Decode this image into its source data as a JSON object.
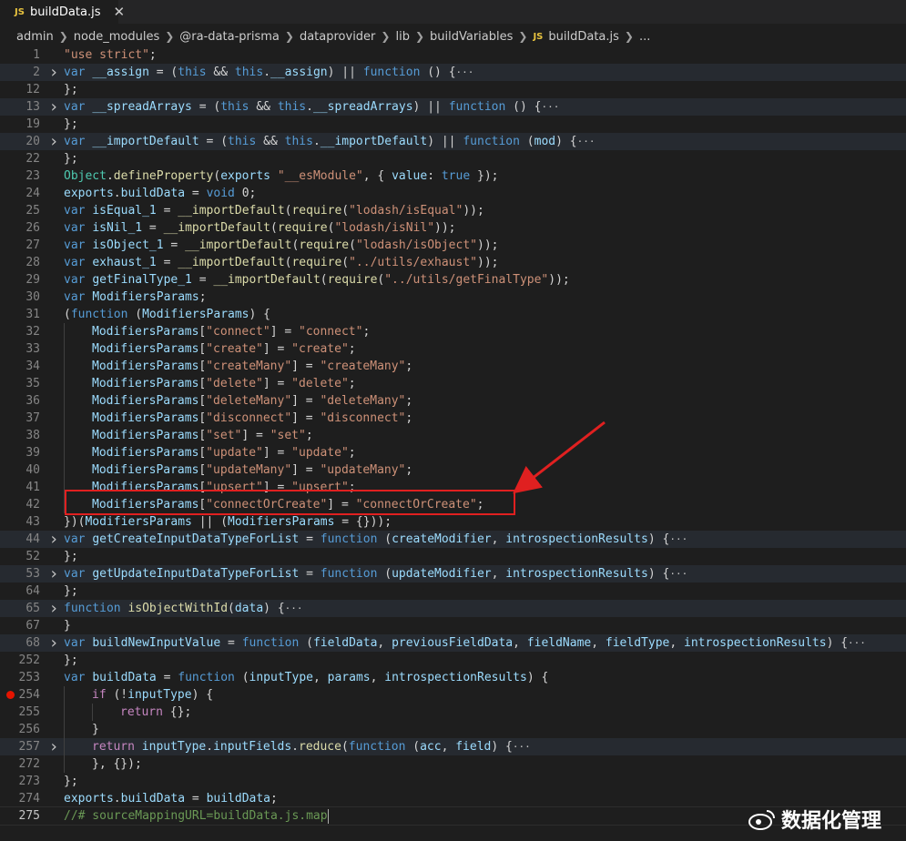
{
  "tab": {
    "badge": "JS",
    "filename": "buildData.js",
    "close": "✕"
  },
  "breadcrumb": {
    "parts": [
      "admin",
      "node_modules",
      "@ra-data-prisma",
      "dataprovider",
      "lib",
      "buildVariables"
    ],
    "file_badge": "JS",
    "file": "buildData.js",
    "tail": "..."
  },
  "lines": [
    {
      "n": "1",
      "t": [
        [
          "str",
          "\"use strict\""
        ],
        [
          "",
          "; "
        ]
      ]
    },
    {
      "n": "2",
      "fold": true,
      "t": [
        [
          "kw",
          "var"
        ],
        [
          "",
          " "
        ],
        [
          "var",
          "__assign"
        ],
        [
          "",
          " = ("
        ],
        [
          "kw",
          "this"
        ],
        [
          "",
          " && "
        ],
        [
          "kw",
          "this"
        ],
        [
          "",
          "."
        ],
        [
          "var",
          "__assign"
        ],
        [
          "",
          ") || "
        ],
        [
          "kw",
          "function"
        ],
        [
          "",
          " () {"
        ],
        [
          "ell",
          "···"
        ]
      ]
    },
    {
      "n": "12",
      "t": [
        [
          "",
          "};"
        ]
      ]
    },
    {
      "n": "13",
      "fold": true,
      "t": [
        [
          "kw",
          "var"
        ],
        [
          "",
          " "
        ],
        [
          "var",
          "__spreadArrays"
        ],
        [
          "",
          " = ("
        ],
        [
          "kw",
          "this"
        ],
        [
          "",
          " && "
        ],
        [
          "kw",
          "this"
        ],
        [
          "",
          "."
        ],
        [
          "var",
          "__spreadArrays"
        ],
        [
          "",
          ") || "
        ],
        [
          "kw",
          "function"
        ],
        [
          "",
          " () {"
        ],
        [
          "ell",
          "···"
        ]
      ]
    },
    {
      "n": "19",
      "t": [
        [
          "",
          "};"
        ]
      ]
    },
    {
      "n": "20",
      "fold": true,
      "t": [
        [
          "kw",
          "var"
        ],
        [
          "",
          " "
        ],
        [
          "var",
          "__importDefault"
        ],
        [
          "",
          " = ("
        ],
        [
          "kw",
          "this"
        ],
        [
          "",
          " && "
        ],
        [
          "kw",
          "this"
        ],
        [
          "",
          "."
        ],
        [
          "var",
          "__importDefault"
        ],
        [
          "",
          ") || "
        ],
        [
          "kw",
          "function"
        ],
        [
          "",
          " ("
        ],
        [
          "var",
          "mod"
        ],
        [
          "",
          ") {"
        ],
        [
          "ell",
          "···"
        ]
      ]
    },
    {
      "n": "22",
      "t": [
        [
          "",
          "};"
        ]
      ]
    },
    {
      "n": "23",
      "t": [
        [
          "cls",
          "Object"
        ],
        [
          "",
          "."
        ],
        [
          "fn",
          "defineProperty"
        ],
        [
          "",
          "("
        ],
        [
          "var",
          "exports"
        ],
        [
          ",",
          ""
        ],
        [
          "",
          " "
        ],
        [
          "str",
          "\"__esModule\""
        ],
        [
          "",
          ", { "
        ],
        [
          "var",
          "value"
        ],
        [
          "",
          ": "
        ],
        [
          "kw",
          "true"
        ],
        [
          "",
          " });"
        ]
      ]
    },
    {
      "n": "24",
      "t": [
        [
          "var",
          "exports"
        ],
        [
          "",
          "."
        ],
        [
          "var",
          "buildData"
        ],
        [
          "",
          " = "
        ],
        [
          "kw",
          "void"
        ],
        [
          "",
          " 0;"
        ]
      ]
    },
    {
      "n": "25",
      "t": [
        [
          "kw",
          "var"
        ],
        [
          "",
          " "
        ],
        [
          "var",
          "isEqual_1"
        ],
        [
          "",
          " = "
        ],
        [
          "fn",
          "__importDefault"
        ],
        [
          "",
          "("
        ],
        [
          "fn",
          "require"
        ],
        [
          "",
          "("
        ],
        [
          "str",
          "\"lodash/isEqual\""
        ],
        [
          "",
          "));"
        ]
      ]
    },
    {
      "n": "26",
      "t": [
        [
          "kw",
          "var"
        ],
        [
          "",
          " "
        ],
        [
          "var",
          "isNil_1"
        ],
        [
          "",
          " = "
        ],
        [
          "fn",
          "__importDefault"
        ],
        [
          "",
          "("
        ],
        [
          "fn",
          "require"
        ],
        [
          "",
          "("
        ],
        [
          "str",
          "\"lodash/isNil\""
        ],
        [
          "",
          "));"
        ]
      ]
    },
    {
      "n": "27",
      "t": [
        [
          "kw",
          "var"
        ],
        [
          "",
          " "
        ],
        [
          "var",
          "isObject_1"
        ],
        [
          "",
          " = "
        ],
        [
          "fn",
          "__importDefault"
        ],
        [
          "",
          "("
        ],
        [
          "fn",
          "require"
        ],
        [
          "",
          "("
        ],
        [
          "str",
          "\"lodash/isObject\""
        ],
        [
          "",
          "));"
        ]
      ]
    },
    {
      "n": "28",
      "t": [
        [
          "kw",
          "var"
        ],
        [
          "",
          " "
        ],
        [
          "var",
          "exhaust_1"
        ],
        [
          "",
          " = "
        ],
        [
          "fn",
          "__importDefault"
        ],
        [
          "",
          "("
        ],
        [
          "fn",
          "require"
        ],
        [
          "",
          "("
        ],
        [
          "str",
          "\"../utils/exhaust\""
        ],
        [
          "",
          "));"
        ]
      ]
    },
    {
      "n": "29",
      "t": [
        [
          "kw",
          "var"
        ],
        [
          "",
          " "
        ],
        [
          "var",
          "getFinalType_1"
        ],
        [
          "",
          " = "
        ],
        [
          "fn",
          "__importDefault"
        ],
        [
          "",
          "("
        ],
        [
          "fn",
          "require"
        ],
        [
          "",
          "("
        ],
        [
          "str",
          "\"../utils/getFinalType\""
        ],
        [
          "",
          "));"
        ]
      ]
    },
    {
      "n": "30",
      "t": [
        [
          "kw",
          "var"
        ],
        [
          "",
          " "
        ],
        [
          "var",
          "ModifiersParams"
        ],
        [
          "",
          ";"
        ]
      ]
    },
    {
      "n": "31",
      "t": [
        [
          "",
          "("
        ],
        [
          "kw",
          "function"
        ],
        [
          "",
          " ("
        ],
        [
          "var",
          "ModifiersParams"
        ],
        [
          "",
          ") {"
        ]
      ]
    },
    {
      "n": "32",
      "i": 1,
      "t": [
        [
          "var",
          "ModifiersParams"
        ],
        [
          "",
          "["
        ],
        [
          "str",
          "\"connect\""
        ],
        [
          "",
          "] = "
        ],
        [
          "str",
          "\"connect\""
        ],
        [
          "",
          ";"
        ]
      ]
    },
    {
      "n": "33",
      "i": 1,
      "t": [
        [
          "var",
          "ModifiersParams"
        ],
        [
          "",
          "["
        ],
        [
          "str",
          "\"create\""
        ],
        [
          "",
          "] = "
        ],
        [
          "str",
          "\"create\""
        ],
        [
          "",
          ";"
        ]
      ]
    },
    {
      "n": "34",
      "i": 1,
      "t": [
        [
          "var",
          "ModifiersParams"
        ],
        [
          "",
          "["
        ],
        [
          "str",
          "\"createMany\""
        ],
        [
          "",
          "] = "
        ],
        [
          "str",
          "\"createMany\""
        ],
        [
          "",
          ";"
        ]
      ]
    },
    {
      "n": "35",
      "i": 1,
      "t": [
        [
          "var",
          "ModifiersParams"
        ],
        [
          "",
          "["
        ],
        [
          "str",
          "\"delete\""
        ],
        [
          "",
          "] = "
        ],
        [
          "str",
          "\"delete\""
        ],
        [
          "",
          ";"
        ]
      ]
    },
    {
      "n": "36",
      "i": 1,
      "t": [
        [
          "var",
          "ModifiersParams"
        ],
        [
          "",
          "["
        ],
        [
          "str",
          "\"deleteMany\""
        ],
        [
          "",
          "] = "
        ],
        [
          "str",
          "\"deleteMany\""
        ],
        [
          "",
          ";"
        ]
      ]
    },
    {
      "n": "37",
      "i": 1,
      "t": [
        [
          "var",
          "ModifiersParams"
        ],
        [
          "",
          "["
        ],
        [
          "str",
          "\"disconnect\""
        ],
        [
          "",
          "] = "
        ],
        [
          "str",
          "\"disconnect\""
        ],
        [
          "",
          ";"
        ]
      ]
    },
    {
      "n": "38",
      "i": 1,
      "t": [
        [
          "var",
          "ModifiersParams"
        ],
        [
          "",
          "["
        ],
        [
          "str",
          "\"set\""
        ],
        [
          "",
          "] = "
        ],
        [
          "str",
          "\"set\""
        ],
        [
          "",
          ";"
        ]
      ]
    },
    {
      "n": "39",
      "i": 1,
      "t": [
        [
          "var",
          "ModifiersParams"
        ],
        [
          "",
          "["
        ],
        [
          "str",
          "\"update\""
        ],
        [
          "",
          "] = "
        ],
        [
          "str",
          "\"update\""
        ],
        [
          "",
          ";"
        ]
      ]
    },
    {
      "n": "40",
      "i": 1,
      "t": [
        [
          "var",
          "ModifiersParams"
        ],
        [
          "",
          "["
        ],
        [
          "str",
          "\"updateMany\""
        ],
        [
          "",
          "] = "
        ],
        [
          "str",
          "\"updateMany\""
        ],
        [
          "",
          ";"
        ]
      ]
    },
    {
      "n": "41",
      "i": 1,
      "t": [
        [
          "var",
          "ModifiersParams"
        ],
        [
          "",
          "["
        ],
        [
          "str",
          "\"upsert\""
        ],
        [
          "",
          "] = "
        ],
        [
          "str",
          "\"upsert\""
        ],
        [
          "",
          ";"
        ]
      ]
    },
    {
      "n": "42",
      "i": 1,
      "t": [
        [
          "var",
          "ModifiersParams"
        ],
        [
          "",
          "["
        ],
        [
          "str",
          "\"connectOrCreate\""
        ],
        [
          "",
          "] = "
        ],
        [
          "str",
          "\"connectOrCreate\""
        ],
        [
          "",
          ";"
        ]
      ]
    },
    {
      "n": "43",
      "t": [
        [
          "",
          "})("
        ],
        [
          "var",
          "ModifiersParams"
        ],
        [
          "",
          " || ("
        ],
        [
          "var",
          "ModifiersParams"
        ],
        [
          "",
          " = {}));"
        ]
      ]
    },
    {
      "n": "44",
      "fold": true,
      "t": [
        [
          "kw",
          "var"
        ],
        [
          "",
          " "
        ],
        [
          "var",
          "getCreateInputDataTypeForList"
        ],
        [
          "",
          " = "
        ],
        [
          "kw",
          "function"
        ],
        [
          "",
          " ("
        ],
        [
          "var",
          "createModifier"
        ],
        [
          "",
          ", "
        ],
        [
          "var",
          "introspectionResults"
        ],
        [
          "",
          ") {"
        ],
        [
          "ell",
          "···"
        ]
      ]
    },
    {
      "n": "52",
      "t": [
        [
          "",
          "};"
        ]
      ]
    },
    {
      "n": "53",
      "fold": true,
      "t": [
        [
          "kw",
          "var"
        ],
        [
          "",
          " "
        ],
        [
          "var",
          "getUpdateInputDataTypeForList"
        ],
        [
          "",
          " = "
        ],
        [
          "kw",
          "function"
        ],
        [
          "",
          " ("
        ],
        [
          "var",
          "updateModifier"
        ],
        [
          "",
          ", "
        ],
        [
          "var",
          "introspectionResults"
        ],
        [
          "",
          ") {"
        ],
        [
          "ell",
          "···"
        ]
      ]
    },
    {
      "n": "64",
      "t": [
        [
          "",
          "};"
        ]
      ]
    },
    {
      "n": "65",
      "fold": true,
      "t": [
        [
          "kw",
          "function"
        ],
        [
          "",
          " "
        ],
        [
          "fn",
          "isObjectWithId"
        ],
        [
          "",
          "("
        ],
        [
          "var",
          "data"
        ],
        [
          "",
          ") {"
        ],
        [
          "ell",
          "···"
        ]
      ]
    },
    {
      "n": "67",
      "t": [
        [
          "",
          "}"
        ]
      ]
    },
    {
      "n": "68",
      "fold": true,
      "t": [
        [
          "kw",
          "var"
        ],
        [
          "",
          " "
        ],
        [
          "var",
          "buildNewInputValue"
        ],
        [
          "",
          " = "
        ],
        [
          "kw",
          "function"
        ],
        [
          "",
          " ("
        ],
        [
          "var",
          "fieldData"
        ],
        [
          "",
          ", "
        ],
        [
          "var",
          "previousFieldData"
        ],
        [
          "",
          ", "
        ],
        [
          "var",
          "fieldName"
        ],
        [
          "",
          ", "
        ],
        [
          "var",
          "fieldType"
        ],
        [
          "",
          ", "
        ],
        [
          "var",
          "introspectionResults"
        ],
        [
          "",
          ") {"
        ],
        [
          "ell",
          "···"
        ]
      ]
    },
    {
      "n": "252",
      "t": [
        [
          "",
          "};"
        ]
      ]
    },
    {
      "n": "253",
      "t": [
        [
          "kw",
          "var"
        ],
        [
          "",
          " "
        ],
        [
          "var",
          "buildData"
        ],
        [
          "",
          " = "
        ],
        [
          "kw",
          "function"
        ],
        [
          "",
          " ("
        ],
        [
          "var",
          "inputType"
        ],
        [
          "",
          ", "
        ],
        [
          "var",
          "params"
        ],
        [
          "",
          ", "
        ],
        [
          "var",
          "introspectionResults"
        ],
        [
          "",
          ") {"
        ]
      ]
    },
    {
      "n": "254",
      "i": 1,
      "bp": true,
      "t": [
        [
          "ctl",
          "if"
        ],
        [
          "",
          " (!"
        ],
        [
          "var",
          "inputType"
        ],
        [
          "",
          ") {"
        ]
      ]
    },
    {
      "n": "255",
      "i": 2,
      "t": [
        [
          "ctl",
          "return"
        ],
        [
          "",
          " {};"
        ]
      ]
    },
    {
      "n": "256",
      "i": 1,
      "t": [
        [
          "",
          "}"
        ]
      ]
    },
    {
      "n": "257",
      "i": 1,
      "fold": true,
      "t": [
        [
          "ctl",
          "return"
        ],
        [
          "",
          " "
        ],
        [
          "var",
          "inputType"
        ],
        [
          "",
          "."
        ],
        [
          "var",
          "inputFields"
        ],
        [
          "",
          "."
        ],
        [
          "fn",
          "reduce"
        ],
        [
          "",
          "("
        ],
        [
          "kw",
          "function"
        ],
        [
          "",
          " ("
        ],
        [
          "var",
          "acc"
        ],
        [
          "",
          ", "
        ],
        [
          "var",
          "field"
        ],
        [
          "",
          ") {"
        ],
        [
          "ell",
          "···"
        ]
      ]
    },
    {
      "n": "272",
      "i": 1,
      "t": [
        [
          "",
          "}, {});"
        ]
      ]
    },
    {
      "n": "273",
      "t": [
        [
          "",
          "};"
        ]
      ]
    },
    {
      "n": "274",
      "t": [
        [
          "var",
          "exports"
        ],
        [
          "",
          "."
        ],
        [
          "var",
          "buildData"
        ],
        [
          "",
          " = "
        ],
        [
          "var",
          "buildData"
        ],
        [
          "",
          ";"
        ]
      ]
    },
    {
      "n": "275",
      "cur": true,
      "t": [
        [
          "cm",
          "//# sourceMappingURL=buildData.js.map"
        ]
      ]
    }
  ],
  "watermark": {
    "text": "数据化管理"
  },
  "annotation": {
    "color": "#e02020"
  }
}
